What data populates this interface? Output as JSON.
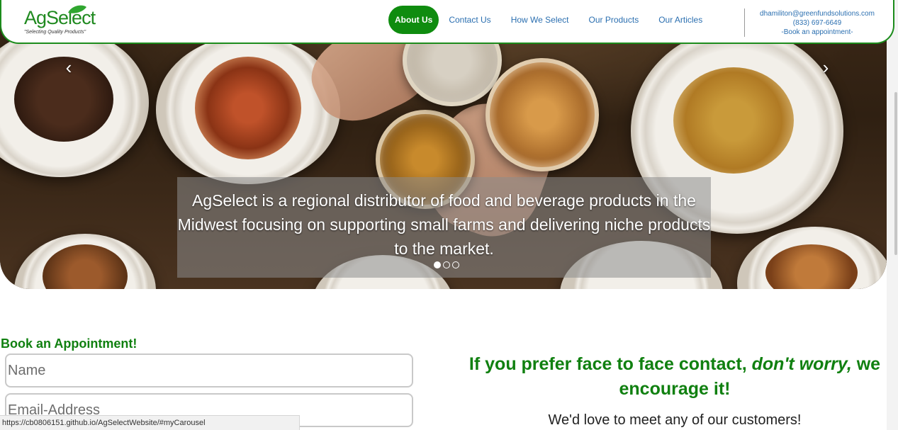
{
  "brand": {
    "name": "AgSelect",
    "tagline": "\"Selecting Quality Products\"",
    "color": "#208a20"
  },
  "nav": {
    "items": [
      {
        "label": "About Us",
        "active": true
      },
      {
        "label": "Contact Us",
        "active": false
      },
      {
        "label": "How We Select",
        "active": false
      },
      {
        "label": "Our Products",
        "active": false
      },
      {
        "label": "Our Articles",
        "active": false
      }
    ],
    "active_color": "#0f8c0f",
    "link_color": "#2b6fb0"
  },
  "contact": {
    "email": "dhamiliton@greenfundsolutions.com",
    "phone": "(833) 697-6649",
    "book_link": "-Book an appointment-"
  },
  "carousel": {
    "caption": "AgSelect is a regional distributor of food and beverage products in the Midwest focusing on supporting small farms and delivering niche products to the market.",
    "prev_icon": "‹",
    "next_icon": "›",
    "slides": 3,
    "active_slide": 1
  },
  "booking": {
    "title": "Book an Appointment!",
    "name_placeholder": "Name",
    "email_placeholder": "Email-Address"
  },
  "face_to_face": {
    "heading_part1": "If you prefer face to face contact, ",
    "heading_emphasis": "don't worry,",
    "heading_part2": " we encourage it!",
    "subtext": "We'd love to meet any of our customers!"
  },
  "status_bar": {
    "url": "https://cb0806151.github.io/AgSelectWebsite/#myCarousel"
  }
}
